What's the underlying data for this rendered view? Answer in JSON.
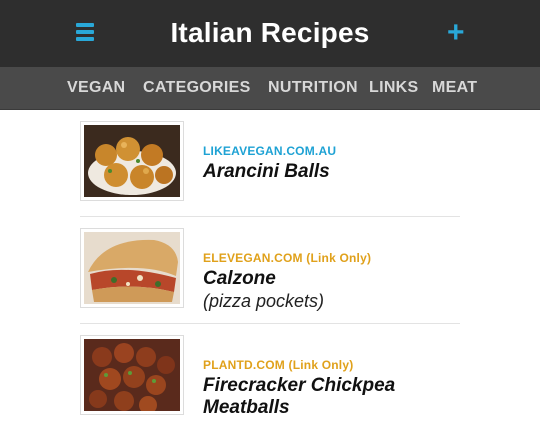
{
  "header": {
    "title": "Italian Recipes",
    "menu_icon": "hamburger-menu-icon",
    "add_icon": "plus-icon"
  },
  "nav": {
    "items": [
      {
        "label": "VEGAN"
      },
      {
        "label": "CATEGORIES"
      },
      {
        "label": "NUTRITION"
      },
      {
        "label": "LINKS"
      },
      {
        "label": "MEAT"
      }
    ]
  },
  "recipes": [
    {
      "source": "LIKEAVEGAN.COM.AU",
      "title": "Arancini Balls",
      "subtitle": "",
      "source_color": "#1ea2d4"
    },
    {
      "source": "ELEVEGAN.COM (Link Only)",
      "title": "Calzone",
      "subtitle": "(pizza pockets)",
      "source_color": "#e0a11b"
    },
    {
      "source": "PLANTD.COM (Link Only)",
      "title": "Firecracker Chickpea Meatballs",
      "subtitle": "",
      "source_color": "#e0a11b"
    }
  ],
  "colors": {
    "accent": "#29a8d8",
    "header_bg": "#2e2e2e",
    "nav_bg": "#4a4a4a"
  }
}
